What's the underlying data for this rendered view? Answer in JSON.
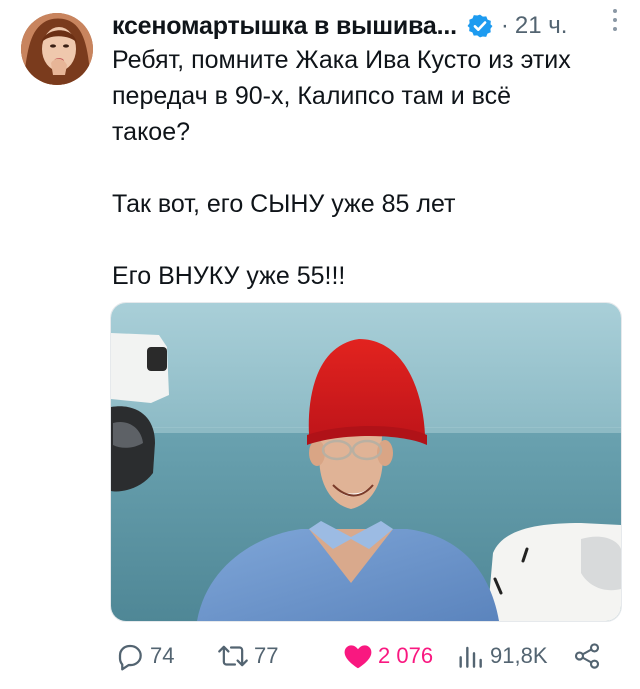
{
  "author": {
    "display_name": "ксеномартышка в вышива...",
    "verified": true,
    "separator": "·",
    "time": "21 ч."
  },
  "icons": {
    "avatar": "avatar-photo",
    "verified": "verified-badge-icon",
    "more": "more-vertical-icon",
    "reply": "reply-icon",
    "retweet": "retweet-icon",
    "like": "heart-icon",
    "views": "views-icon",
    "share": "share-icon"
  },
  "tweet": {
    "lines": [
      "Ребят, помните Жака Ива Кусто из этих",
      "передач в 90-х, Калипсо там и всё",
      "такое?",
      "Так вот, его СЫНУ уже 85 лет",
      "Его ВНУКУ уже 55!!!"
    ]
  },
  "media": {
    "kind": "photo",
    "subject": "man-in-red-hat"
  },
  "actions": {
    "replies": "74",
    "retweets": "77",
    "likes": "2 076",
    "views": "91,8K"
  },
  "colors": {
    "text": "#0f1419",
    "secondary": "#536471",
    "like": "#f91880",
    "verified": "#1d9bf0"
  }
}
